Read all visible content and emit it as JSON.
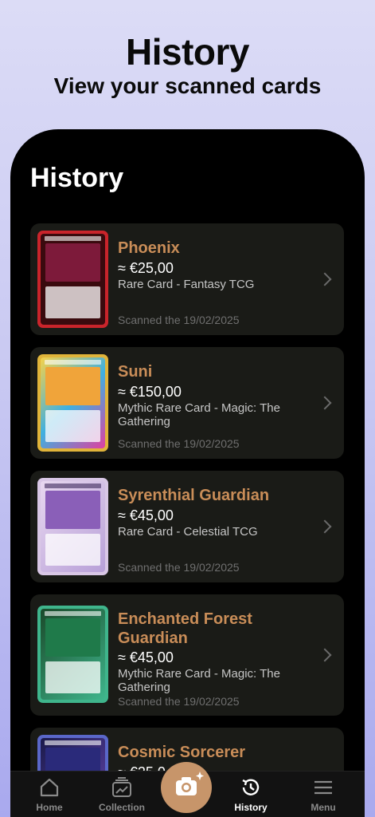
{
  "promo": {
    "title": "History",
    "subtitle": "View your scanned cards"
  },
  "screen": {
    "title": "History"
  },
  "cards": [
    {
      "name": "Phoenix",
      "price": "≈ €25,00",
      "rarity": "Rare Card - Fantasy TCG",
      "scanned": "Scanned the 19/02/2025",
      "thumb_frame": "#c9242b",
      "thumb_art": "#7d1a3a"
    },
    {
      "name": "Suni",
      "price": "≈ €150,00",
      "rarity": "Mythic Rare Card - Magic: The Gathering",
      "scanned": "Scanned the 19/02/2025",
      "thumb_frame": "#e0b43a",
      "thumb_art": "#f0a43a"
    },
    {
      "name": "Syrenthial Guardian",
      "price": "≈ €45,00",
      "rarity": "Rare Card - Celestial TCG",
      "scanned": "Scanned the 19/02/2025",
      "thumb_frame": "#d9c7e6",
      "thumb_art": "#8a5fb8"
    },
    {
      "name": "Enchanted Forest Guardian",
      "price": "≈ €45,00",
      "rarity": "Mythic Rare Card - Magic: The Gathering",
      "scanned": "Scanned the 19/02/2025",
      "thumb_frame": "#3fb58c",
      "thumb_art": "#1f7a4a"
    },
    {
      "name": "Cosmic Sorcerer",
      "price": "≈ €25,0",
      "rarity": "",
      "scanned": "",
      "thumb_frame": "#5a67c9",
      "thumb_art": "#2a2a7a"
    }
  ],
  "tabbar": {
    "home": "Home",
    "collection": "Collection",
    "history": "History",
    "menu": "Menu"
  },
  "colors": {
    "accent": "#c98d58",
    "scan_button": "#c7956a"
  }
}
